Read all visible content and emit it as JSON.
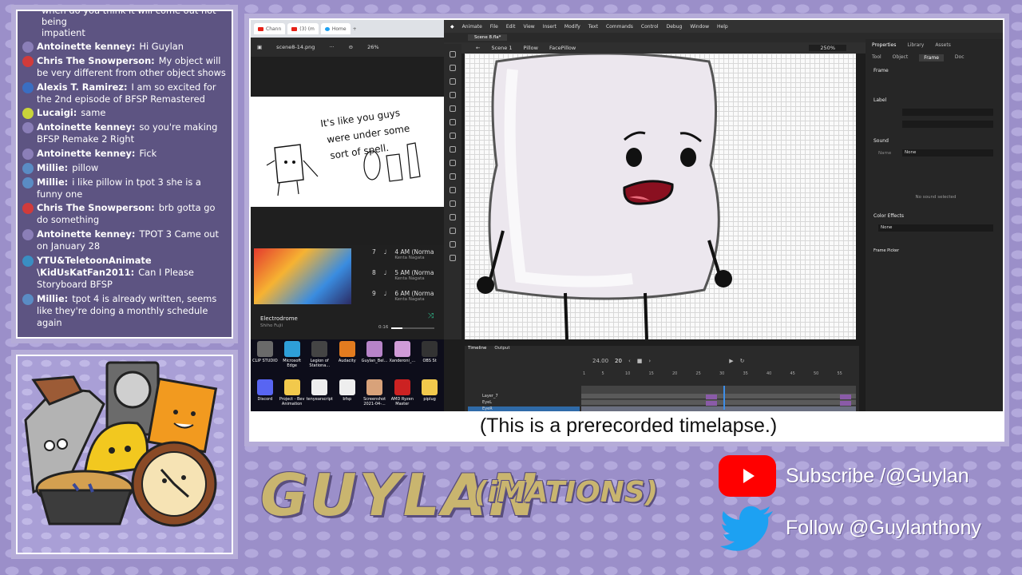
{
  "chat": {
    "first_line_1": "when do you think it will come out not being",
    "first_line_2": "impatient",
    "messages": [
      {
        "name": "Antoinette kenney:",
        "text": "Hi Guylan",
        "color": "#8b7fb8"
      },
      {
        "name": "Chris The Snowperson:",
        "text": "My object will be very different from other object shows",
        "color": "#d13b3b"
      },
      {
        "name": "Alexis T. Ramirez:",
        "text": "I am so excited for the 2nd episode of BFSP Remastered",
        "color": "#3a6ec2"
      },
      {
        "name": "Lucaigi:",
        "text": "same",
        "color": "#c9d43a"
      },
      {
        "name": "Antoinette kenney:",
        "text": "so you're making BFSP Remake 2 Right",
        "color": "#8b7fb8"
      },
      {
        "name": "Antoinette kenney:",
        "text": "Fick",
        "color": "#8b7fb8"
      },
      {
        "name": "Millie:",
        "text": "pillow",
        "color": "#5a8cc4"
      },
      {
        "name": "Millie:",
        "text": "i like pillow in tpot 3 she is a funny one",
        "color": "#5a8cc4"
      },
      {
        "name": "Chris The Snowperson:",
        "text": "brb gotta go do something",
        "color": "#d13b3b"
      },
      {
        "name": "Antoinette kenney:",
        "text": "TPOT 3 Came out on January 28",
        "color": "#8b7fb8"
      },
      {
        "name": "YTU&TeletoonAnimate \\KidUsKatFan2011:",
        "text": "Can I Please Storyboard BFSP",
        "color": "#3a8ec2"
      },
      {
        "name": "Millie:",
        "text": "tpot 4 is already written, seems like they're doing a monthly schedule again",
        "color": "#5a8cc4"
      }
    ]
  },
  "browser": {
    "tabs": [
      "Chann",
      "(3) (m",
      "Home"
    ],
    "file_name": "scene8-14.png",
    "zoom": "26%"
  },
  "sketch_text": [
    "It's like you guys",
    "were under some",
    "sort of spell."
  ],
  "music": {
    "tracks": [
      {
        "num": "7",
        "title": "4 AM (Norma",
        "artist": "Kenta Nagata"
      },
      {
        "num": "8",
        "title": "5 AM (Norma",
        "artist": "Kenta Nagata"
      },
      {
        "num": "9",
        "title": "6 AM (Norma",
        "artist": "Kenta Nagata"
      }
    ],
    "now_title": "Electrodrome",
    "now_artist": "Shiho Fujii",
    "time": "0:16",
    "progress": 0.25
  },
  "desktop_icons": [
    {
      "label": "CLIP STUDIO",
      "color": "#6a6a6a"
    },
    {
      "label": "Microsoft Edge",
      "color": "#2e9fd8"
    },
    {
      "label": "Legion of Stationa...",
      "color": "#444"
    },
    {
      "label": "Audacity",
      "color": "#e27b1f"
    },
    {
      "label": "Guylan_Bel...",
      "color": "#b784c9"
    },
    {
      "label": "Xanderoni_...",
      "color": "#d09bd8"
    },
    {
      "label": "OBS St",
      "color": "#333"
    },
    {
      "label": "Discord",
      "color": "#5865f2"
    },
    {
      "label": "Project - Bev Animation",
      "color": "#f2c94c"
    },
    {
      "label": "tenyearscript",
      "color": "#eee"
    },
    {
      "label": "bfsp",
      "color": "#eee"
    },
    {
      "label": "Screenshot 2021-04-...",
      "color": "#d8a27a"
    },
    {
      "label": "AMD Ryzen Master",
      "color": "#c22"
    },
    {
      "label": "piplug",
      "color": "#f2c94c"
    }
  ],
  "animate": {
    "app_name": "Animate",
    "menu": [
      "File",
      "Edit",
      "View",
      "Insert",
      "Modify",
      "Text",
      "Commands",
      "Control",
      "Debug",
      "Window",
      "Help"
    ],
    "doc_tab": "Scene 8.fla*",
    "breadcrumb": [
      "Scene 1",
      "Pillow",
      "FacePillow"
    ],
    "zoom": "250%",
    "props_tabs": [
      "Tool",
      "Object",
      "Frame",
      "Doc"
    ],
    "props_panel_tabs": [
      "Properties",
      "Library",
      "Assets"
    ],
    "sections": {
      "frame": "Frame",
      "label": "Label",
      "sound": "Sound",
      "sound_name_label": "Name",
      "sound_name": "None",
      "no_sound": "No sound selected",
      "color_effects": "Color Effects",
      "color_value": "None",
      "frame_picker": "Frame Picker"
    },
    "timeline_tabs": [
      "Timeline",
      "Output"
    ],
    "fps": "24.00",
    "frame": "20",
    "layers": [
      "Layer_7",
      "EyeL",
      "EyeR"
    ],
    "ruler": [
      "1",
      "5",
      "10",
      "15",
      "20",
      "25",
      "30",
      "35",
      "40",
      "45",
      "50",
      "55"
    ]
  },
  "caption": "(This is a prerecorded timelapse.)",
  "brand": {
    "main": "GUYLAN",
    "sub": "(iMATIONS)"
  },
  "social": {
    "subscribe": "Subscribe /@Guylan",
    "follow": "Follow @Guylanthony"
  }
}
